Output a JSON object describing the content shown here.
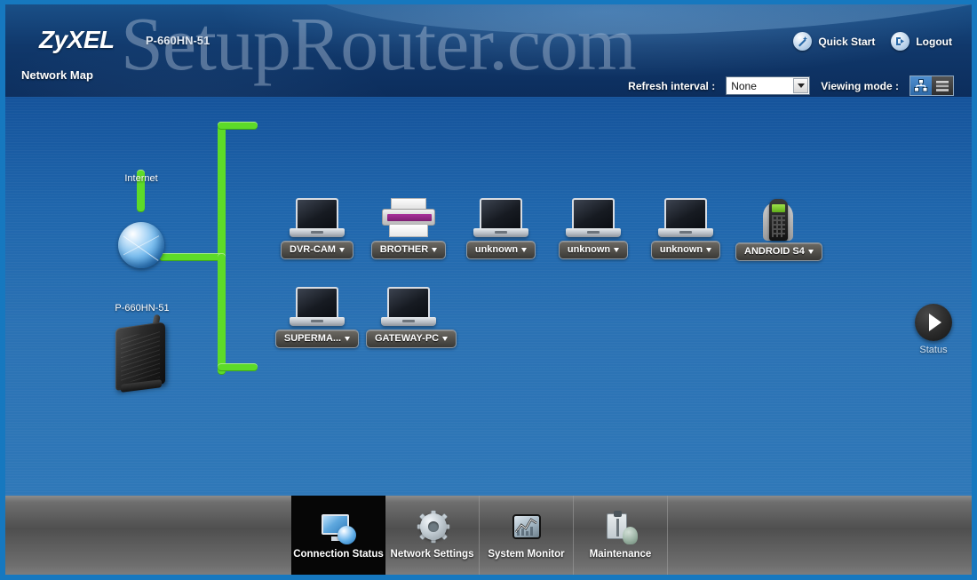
{
  "header": {
    "brand": "ZyXEL",
    "model": "P-660HN-51",
    "page_title": "Network Map",
    "watermark": "SetupRouter.com",
    "actions": [
      {
        "label": "Quick Start",
        "icon": "magic-wand-icon"
      },
      {
        "label": "Logout",
        "icon": "logout-icon"
      }
    ]
  },
  "toolbar": {
    "refresh_label": "Refresh interval :",
    "refresh_value": "None",
    "viewing_mode_label": "Viewing mode :",
    "view_modes": [
      {
        "name": "topology-view",
        "selected": true
      },
      {
        "name": "list-view",
        "selected": false
      }
    ]
  },
  "map": {
    "internet_label": "Internet",
    "router_label": "P-660HN-51",
    "devices_row1": [
      {
        "name": "DVR-CAM",
        "type": "laptop"
      },
      {
        "name": "BROTHER",
        "type": "printer"
      },
      {
        "name": "unknown",
        "type": "laptop"
      },
      {
        "name": "unknown",
        "type": "laptop"
      },
      {
        "name": "unknown",
        "type": "laptop"
      },
      {
        "name": "ANDROID S4",
        "type": "phone"
      }
    ],
    "devices_row2": [
      {
        "name": "SUPERMA...",
        "type": "laptop"
      },
      {
        "name": "GATEWAY-PC",
        "type": "laptop"
      }
    ],
    "status_button_label": "Status"
  },
  "nav": {
    "items": [
      {
        "label": "Connection Status",
        "icon": "monitor-globe-icon",
        "active": true
      },
      {
        "label": "Network Settings",
        "icon": "gear-icon",
        "active": false
      },
      {
        "label": "System Monitor",
        "icon": "chart-icon",
        "active": false
      },
      {
        "label": "Maintenance",
        "icon": "clipboard-tools-icon",
        "active": false
      }
    ]
  },
  "colors": {
    "accent_blue": "#1678bf",
    "link_green": "#5ddb28",
    "header_dark": "#0c2d5c",
    "footer_gray": "#4f4f4f"
  }
}
